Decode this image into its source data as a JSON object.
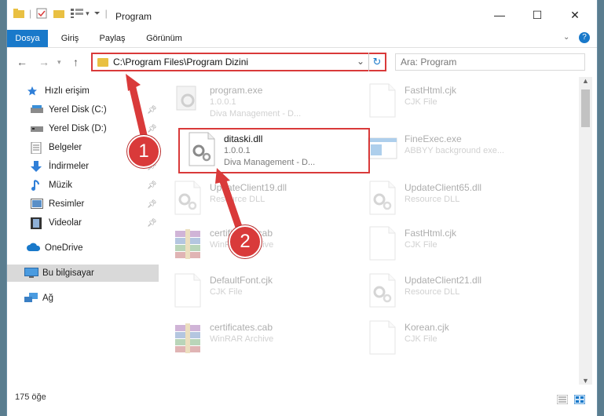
{
  "window": {
    "title": "Program",
    "controls": {
      "minimize": "—",
      "maximize": "☐",
      "close": "✕"
    }
  },
  "ribbon": {
    "tabs": [
      {
        "label": "Dosya",
        "active": true
      },
      {
        "label": "Giriş",
        "active": false
      },
      {
        "label": "Paylaş",
        "active": false
      },
      {
        "label": "Görünüm",
        "active": false
      }
    ],
    "help": "?"
  },
  "address": {
    "path": "C:\\Program Files\\Program Dizini",
    "search_placeholder": "Ara: Program"
  },
  "nav": {
    "items": [
      {
        "label": "Hızlı erişim",
        "icon": "star-icon",
        "pinned": false
      },
      {
        "label": "Yerel Disk (C:)",
        "icon": "drive-icon",
        "pinned": true
      },
      {
        "label": "Yerel Disk (D:)",
        "icon": "drive-icon",
        "pinned": true
      },
      {
        "label": "Belgeler",
        "icon": "documents-icon",
        "pinned": true
      },
      {
        "label": "İndirmeler",
        "icon": "download-icon",
        "pinned": true
      },
      {
        "label": "Müzik",
        "icon": "music-icon",
        "pinned": true
      },
      {
        "label": "Resimler",
        "icon": "pictures-icon",
        "pinned": true
      },
      {
        "label": "Videolar",
        "icon": "videos-icon",
        "pinned": true
      },
      {
        "label": "OneDrive",
        "icon": "cloud-icon",
        "pinned": false
      },
      {
        "label": "Bu bilgisayar",
        "icon": "computer-icon",
        "pinned": false
      },
      {
        "label": "Ağ",
        "icon": "network-icon",
        "pinned": false
      }
    ]
  },
  "files": [
    {
      "name": "program.exe",
      "line1": "1.0.0.1",
      "line2": "Diva Management - D...",
      "icon": "exe-icon",
      "faded": true
    },
    {
      "name": "FastHtml.cjk",
      "line1": "CJK File",
      "line2": "",
      "icon": "file-icon",
      "faded": true
    },
    {
      "name": "ditaski.dll",
      "line1": "1.0.0.1",
      "line2": "Diva Management - D...",
      "icon": "dll-gear-icon",
      "faded": false
    },
    {
      "name": "FineExec.exe",
      "line1": "ABBYY background exe...",
      "line2": "",
      "icon": "window-icon",
      "faded": true
    },
    {
      "name": "UpdateClient19.dll",
      "line1": "Resource DLL",
      "line2": "",
      "icon": "dll-gear-icon",
      "faded": true
    },
    {
      "name": "UpdateClient65.dll",
      "line1": "Resource DLL",
      "line2": "",
      "icon": "dll-gear-icon",
      "faded": true
    },
    {
      "name": "certificates.cab",
      "line1": "WinRAR Archive",
      "line2": "",
      "icon": "archive-icon",
      "faded": true
    },
    {
      "name": "FastHtml.cjk",
      "line1": "CJK File",
      "line2": "",
      "icon": "file-icon",
      "faded": true
    },
    {
      "name": "DefaultFont.cjk",
      "line1": "CJK File",
      "line2": "",
      "icon": "file-icon",
      "faded": true
    },
    {
      "name": "UpdateClient21.dll",
      "line1": "Resource DLL",
      "line2": "",
      "icon": "dll-gear-icon",
      "faded": true
    },
    {
      "name": "certificates.cab",
      "line1": "WinRAR Archive",
      "line2": "",
      "icon": "archive-icon",
      "faded": true
    },
    {
      "name": "Korean.cjk",
      "line1": "CJK File",
      "line2": "",
      "icon": "file-icon",
      "faded": true
    }
  ],
  "status": {
    "count": "175 öğe"
  },
  "callouts": {
    "one": "1",
    "two": "2"
  },
  "colors": {
    "accent": "#1979ca",
    "highlight": "#d93a3a"
  }
}
